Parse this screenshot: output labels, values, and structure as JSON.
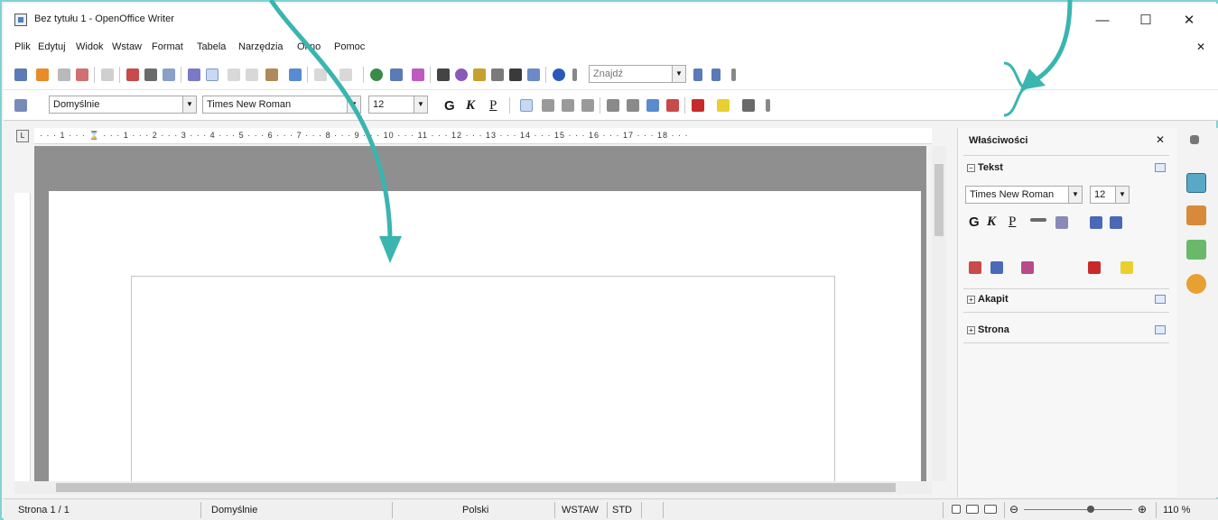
{
  "window": {
    "title": "Bez tytułu 1 - OpenOffice Writer",
    "controls": {
      "minimize": "—",
      "maximize": "☐",
      "close": "✕"
    }
  },
  "menubar": {
    "items": [
      "Plik",
      "Edytuj",
      "Widok",
      "Wstaw",
      "Format",
      "Tabela",
      "Narzędzia",
      "Okno",
      "Pomoc"
    ],
    "close_doc": "✕"
  },
  "toolbar_standard": {
    "find_placeholder": "Znajdź"
  },
  "toolbar_formatting": {
    "style_value": "Domyślnie",
    "font_value": "Times New Roman",
    "size_value": "12",
    "bold": "G",
    "italic": "K",
    "underline": "P"
  },
  "ruler": {
    "labels": "· · · 1 · · · ⌛ · · · 1 · · · 2 · · · 3 · · · 4 · · · 5 · · · 6 · · · 7 · · · 8 · · · 9 · · · 10 · · · 11 · · · 12 · · · 13 · · · 14 · · · 15 · · · 16 · · · 17 · · · 18 · · ·"
  },
  "sidebar": {
    "title": "Właściwości",
    "close": "✕",
    "sections": {
      "text": "Tekst",
      "paragraph": "Akapit",
      "page": "Strona"
    },
    "font_value": "Times New Roman",
    "size_value": "12",
    "bold": "G",
    "italic": "K",
    "underline": "P"
  },
  "statusbar": {
    "page": "Strona  1 / 1",
    "style": "Domyślnie",
    "language": "Polski",
    "insert_mode": "WSTAW",
    "selection_mode": "STD",
    "zoom": "110 %"
  },
  "colors": {
    "annotation_accent": "#3ab5b0",
    "frame_border": "#7fd3d3",
    "doc_background": "#8f8f8f"
  }
}
